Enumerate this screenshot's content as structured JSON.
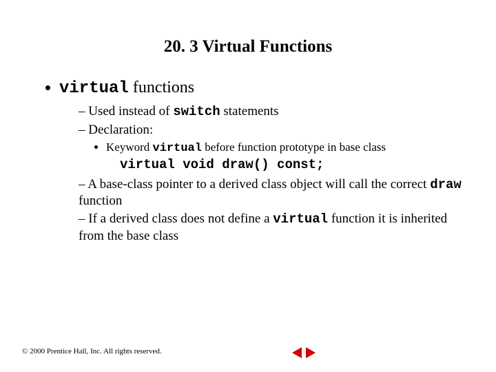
{
  "title": "20. 3 Virtual Functions",
  "bullet_l1_pre": "virtual",
  "bullet_l1_post": " functions",
  "l2_a_pre": "Used instead of ",
  "l2_a_code": "switch",
  "l2_a_post": " statements",
  "l2_b": "Declaration:",
  "l3_a_pre": "Keyword ",
  "l3_a_code": "virtual",
  "l3_a_post": " before function prototype in base class",
  "code_line": "virtual void draw() const;",
  "l2_c_pre": "A base-class pointer to a derived class object will call the correct ",
  "l2_c_code": "draw",
  "l2_c_post": " function",
  "l2_d_pre": "If a derived class does not define a ",
  "l2_d_code": "virtual",
  "l2_d_post": " function it is inherited from the base class",
  "footer": "© 2000 Prentice Hall, Inc. All rights reserved."
}
